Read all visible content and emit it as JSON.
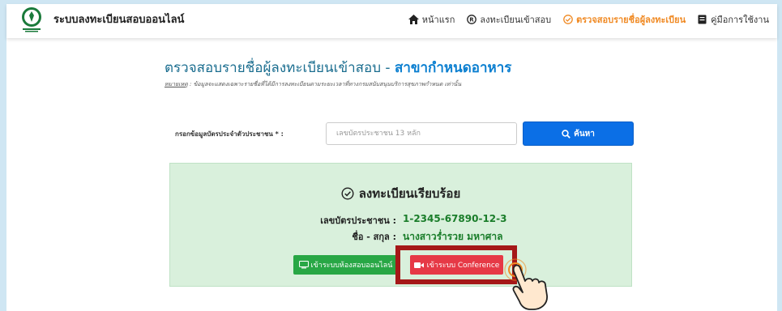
{
  "header": {
    "brand": "ระบบลงทะเบียนสอบออนไลน์",
    "nav": [
      {
        "label": "หน้าแรก",
        "icon": "home-icon"
      },
      {
        "label": "ลงทะเบียนเข้าสอบ",
        "icon": "registered-icon"
      },
      {
        "label": "ตรวจสอบรายชื่อผู้ลงทะเบียน",
        "icon": "check-circle-icon",
        "active": true
      },
      {
        "label": "คู่มือการใช้งาน",
        "icon": "book-icon"
      }
    ]
  },
  "main": {
    "title": "ตรวจสอบรายชื่อผู้ลงทะเบียนเข้าสอบ - ",
    "branch": "สาขากำหนดอาหาร",
    "note_label": "หมายเหตุ",
    "note_text": " : ข้อมูลจะแสดงเฉพาะรายชื่อที่ได้มีการลงทะเบียนตามระยะเวลาที่ทางกรมสนับสนุนบริการสุขภาพกำหนด เท่านั้น"
  },
  "search": {
    "label": "กรอกข้อมูลบัตรประจำตัวประชาชน * :",
    "placeholder": "เลขบัตรประชาชน 13 หลัก",
    "button": "ค้นหา"
  },
  "result": {
    "status": "ลงทะเบียนเรียบร้อย",
    "id_label": "เลขบัตรประชาชน :",
    "id_value": "1-2345-67890-12-3",
    "name_label": "ชื่อ - สกุล :",
    "name_value": "นางสาวร่ำรวย มหาศาล",
    "room_button": "เข้าระบบห้องสอบออนไลน์",
    "conf_button": "เข้าระบบ Conference"
  },
  "colors": {
    "accent": "#f08a24",
    "primary": "#0b6fe6",
    "success_bg": "#d9f0dc",
    "highlight": "#a51818"
  }
}
